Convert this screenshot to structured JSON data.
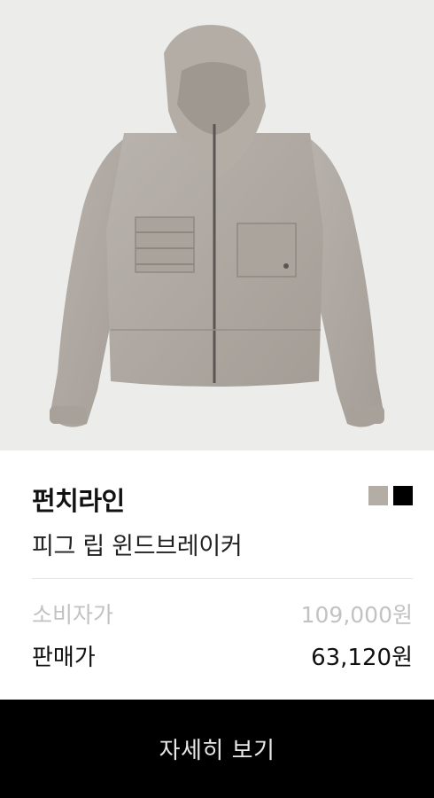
{
  "product": {
    "image_alt": "jacket-image",
    "brand": "펀치라인",
    "name": "피그 립 윈드브레이커",
    "colors": [
      "#b4ada6",
      "#000000"
    ]
  },
  "pricing": {
    "retail_label": "소비자가",
    "retail_value": "109,000원",
    "sale_label": "판매가",
    "sale_value": "63,120원"
  },
  "cta": {
    "label": "자세히 보기"
  }
}
